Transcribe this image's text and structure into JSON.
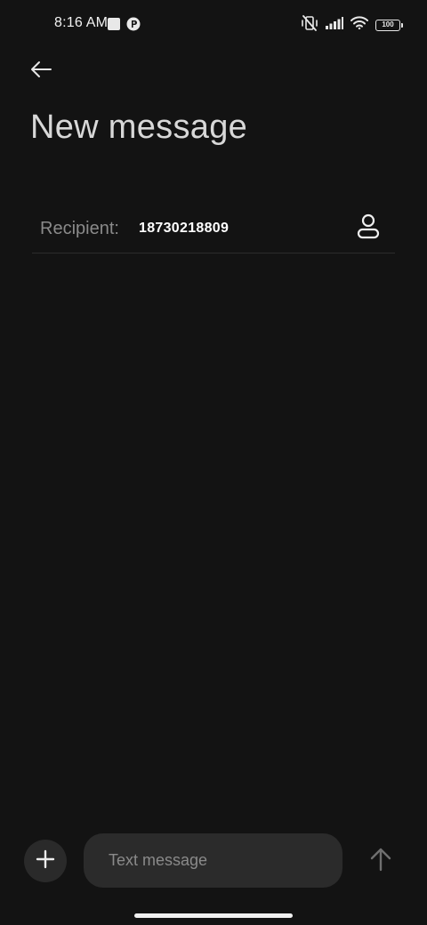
{
  "status_bar": {
    "time": "8:16 AM",
    "battery_level": "100",
    "icons": [
      "notification-square-icon",
      "app-notification-icon",
      "vibrate-off-icon",
      "cellular-signal-icon",
      "wifi-icon",
      "battery-icon"
    ]
  },
  "header": {
    "back_icon": "arrow-left-icon",
    "title": "New message"
  },
  "recipient": {
    "label": "Recipient:",
    "value": "18730218809",
    "contact_icon": "person-outline-icon"
  },
  "compose": {
    "attach_icon": "plus-icon",
    "placeholder": "Text message",
    "send_icon": "arrow-up-icon"
  },
  "colors": {
    "background": "#131313",
    "surface": "#2b2b2b",
    "primary_text": "#ffffff",
    "secondary_text": "#8a8a8a"
  }
}
